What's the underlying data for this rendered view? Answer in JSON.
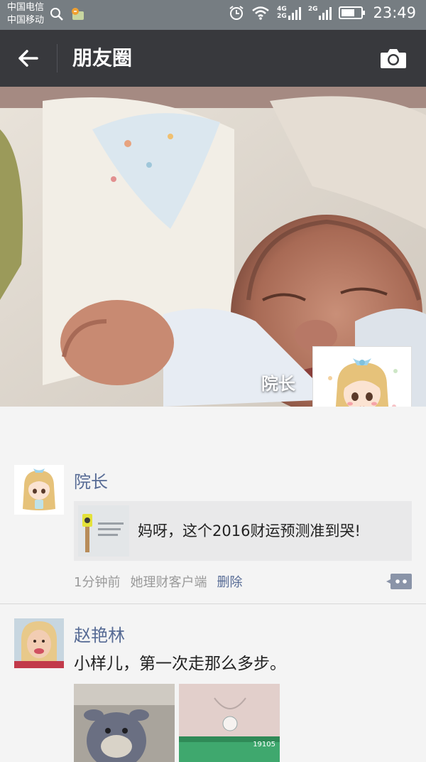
{
  "status_bar": {
    "carrier_1": "中国电信",
    "carrier_2": "中国移动",
    "net_4g": "4G",
    "net_2g_a": "2G",
    "net_2g_b": "2G",
    "time": "23:49"
  },
  "app_bar": {
    "title": "朋友圈"
  },
  "cover": {
    "user_name": "院长"
  },
  "posts": [
    {
      "author": "院长",
      "link_title": "妈呀，这个2016财运预测准到哭!",
      "time_ago": "1分钟前",
      "source": "她理财客户端",
      "delete_label": "删除"
    },
    {
      "author": "赵艳林",
      "text": "小样儿，第一次走那么多步。",
      "image_2_counter": "19105"
    }
  ],
  "colors": {
    "status_bar": "#767d82",
    "app_bar": "#38393d",
    "link_blue": "#576b95",
    "feed_bg": "#f4f4f4"
  }
}
